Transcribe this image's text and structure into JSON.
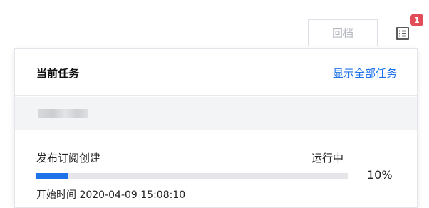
{
  "toolbar": {
    "restore_label": "回档",
    "task_list_icon": "task-list-icon",
    "badge_count": "1",
    "badge_color": "#e34d59"
  },
  "popover": {
    "title": "当前任务",
    "show_all_label": "显示全部任务",
    "accent_color": "#1e73e8",
    "task": {
      "name": "发布订阅创建",
      "status": "运行中",
      "progress": 0.1,
      "progress_label": "10%",
      "start_time": "开始时间 2020-04-09 15:08:10"
    }
  }
}
